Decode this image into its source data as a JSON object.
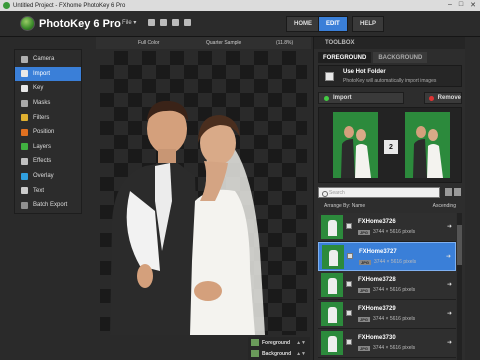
{
  "window": {
    "title": "Untitled Project - FXhome PhotoKey 6 Pro"
  },
  "app": {
    "logo_text": "PhotoKey 6 Pro",
    "file_menu": "File ▾"
  },
  "nav": {
    "home": "HOME",
    "edit": "EDIT",
    "help": "HELP"
  },
  "options": {
    "color": "Full Color",
    "sample": "Quarter Sample",
    "zoom": "(11.8%)"
  },
  "sidebar": {
    "items": [
      {
        "label": "Camera",
        "icon": "camera-icon",
        "color": "#b0b0b0"
      },
      {
        "label": "Import",
        "icon": "import-icon",
        "color": "#e8e8e8"
      },
      {
        "label": "Key",
        "icon": "key-icon",
        "color": "#e8e8e8"
      },
      {
        "label": "Masks",
        "icon": "mask-icon",
        "color": "#aaaaaa"
      },
      {
        "label": "Filters",
        "icon": "filters-icon",
        "color": "#e0b030"
      },
      {
        "label": "Position",
        "icon": "position-icon",
        "color": "#e07020"
      },
      {
        "label": "Layers",
        "icon": "layers-icon",
        "color": "#40b040"
      },
      {
        "label": "Effects",
        "icon": "effects-icon",
        "color": "#c0c0c0"
      },
      {
        "label": "Overlay",
        "icon": "overlay-icon",
        "color": "#30a0e0"
      },
      {
        "label": "Text",
        "icon": "text-icon",
        "color": "#cccccc"
      },
      {
        "label": "Batch Export",
        "icon": "batch-export-icon",
        "color": "#909090"
      }
    ]
  },
  "layers": {
    "foreground": "Foreground",
    "background": "Background"
  },
  "toolbox": {
    "header": "TOOLBOX",
    "tab_foreground": "FOREGROUND",
    "tab_background": "BACKGROUND",
    "hot_folder_title": "Use Hot Folder",
    "hot_folder_sub": "PhotoKey will automatically import images",
    "import_label": "Import",
    "remove_label": "Remove",
    "preview_count": "2",
    "search_placeholder": "Search",
    "arrange_label": "Arrange By: Name",
    "order_label": "Ascending"
  },
  "files": [
    {
      "name": "FXHome3726",
      "format": "JPG",
      "size": "3744 × 5616 pixels"
    },
    {
      "name": "FXHome3727",
      "format": "JPG",
      "size": "3744 × 5616 pixels"
    },
    {
      "name": "FXHome3728",
      "format": "JPG",
      "size": "3744 × 5616 pixels"
    },
    {
      "name": "FXHome3729",
      "format": "JPG",
      "size": "3744 × 5616 pixels"
    },
    {
      "name": "FXHome3730",
      "format": "JPG",
      "size": "3744 × 5616 pixels"
    }
  ],
  "selected_index": 1
}
